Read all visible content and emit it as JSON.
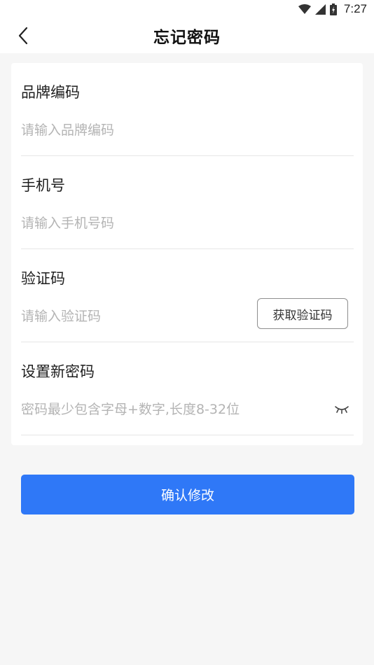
{
  "status_bar": {
    "time": "7:27",
    "icons": [
      "wifi-icon",
      "signal-icon",
      "battery-icon"
    ]
  },
  "nav": {
    "title": "忘记密码",
    "back_icon": "chevron-left-icon"
  },
  "form": {
    "brand_code": {
      "label": "品牌编码",
      "placeholder": "请输入品牌编码",
      "value": ""
    },
    "phone": {
      "label": "手机号",
      "placeholder": "请输入手机号码",
      "value": ""
    },
    "verify_code": {
      "label": "验证码",
      "placeholder": "请输入验证码",
      "value": "",
      "button_label": "获取验证码"
    },
    "new_password": {
      "label": "设置新密码",
      "placeholder": "密码最少包含字母+数字,长度8-32位",
      "value": "",
      "toggle_icon": "eye-closed-icon"
    }
  },
  "submit": {
    "label": "确认修改"
  },
  "colors": {
    "primary": "#2f78f7",
    "background": "#f6f6f6",
    "placeholder": "#b4b4b4",
    "divider": "#e6e6e6"
  }
}
